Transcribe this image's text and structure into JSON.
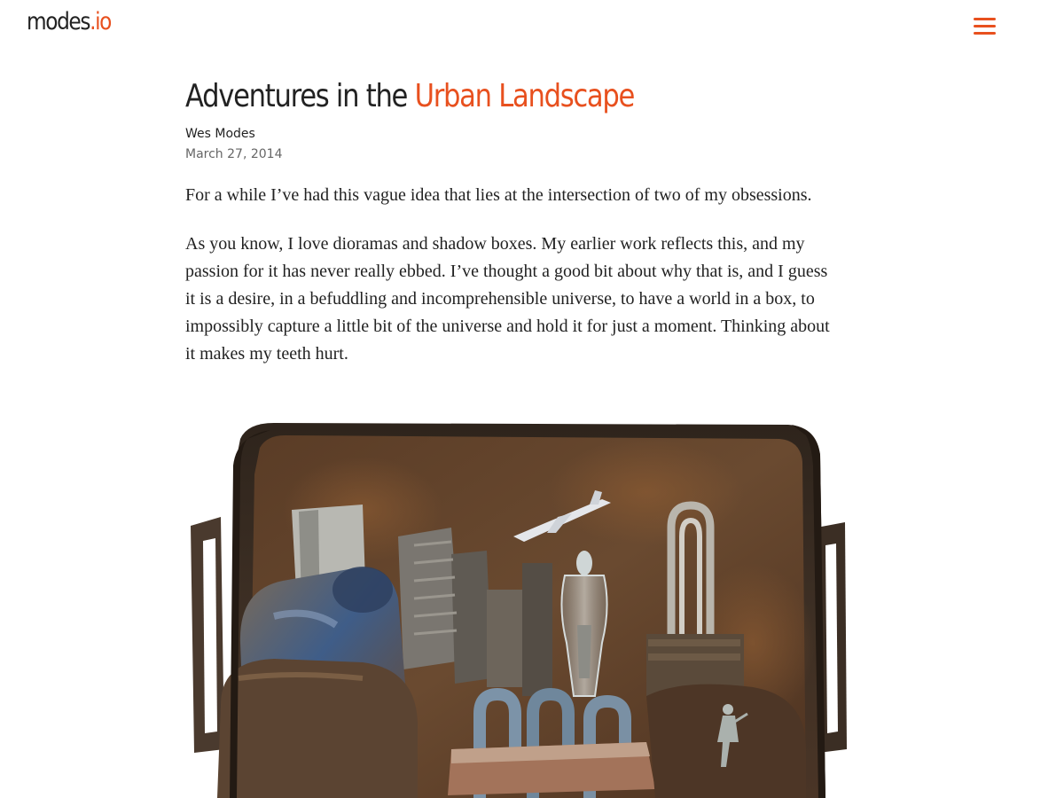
{
  "header": {
    "logo_main": "modes",
    "logo_accent": ".io",
    "menu_icon": "hamburger-menu-icon"
  },
  "article": {
    "title_plain": "Adventures in the ",
    "title_accent": "Urban Landscape",
    "author": "Wes Modes",
    "date": "March 27, 2014",
    "paragraphs": [
      "For a while I’ve had this vague idea that lies at the intersection of two of my obsessions.",
      "As you know, I love dioramas and shadow boxes. My earlier work reflects this, and my passion for it has never really ebbed. I’ve thought a good bit about why that is, and I guess it is a desire, in a befuddling and incomprehensible universe, to have a world in a box, to impossibly capture a little bit of the universe and hold it for just a moment. Thinking about it makes my teeth hurt."
    ]
  },
  "colors": {
    "accent": "#e8501e",
    "text": "#222222",
    "muted": "#666666"
  }
}
